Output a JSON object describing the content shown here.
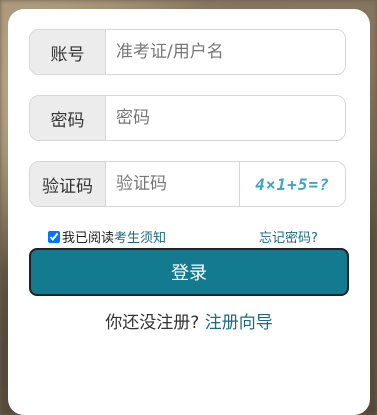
{
  "form": {
    "account": {
      "label": "账号",
      "placeholder": "准考证/用户名",
      "value": ""
    },
    "password": {
      "label": "密码",
      "placeholder": "密码",
      "value": ""
    },
    "captcha": {
      "label": "验证码",
      "placeholder": "验证码",
      "value": "",
      "image_text": "4×1+5=?"
    },
    "agree": {
      "checked": true,
      "prefix": "我已阅读",
      "link_text": "考生须知"
    },
    "forgot_label": "忘记密码?",
    "login_label": "登录",
    "register": {
      "prompt": "你还没注册?",
      "link_text": "注册向导"
    }
  },
  "colors": {
    "primary": "#137a8f",
    "link": "#1c6a84"
  }
}
